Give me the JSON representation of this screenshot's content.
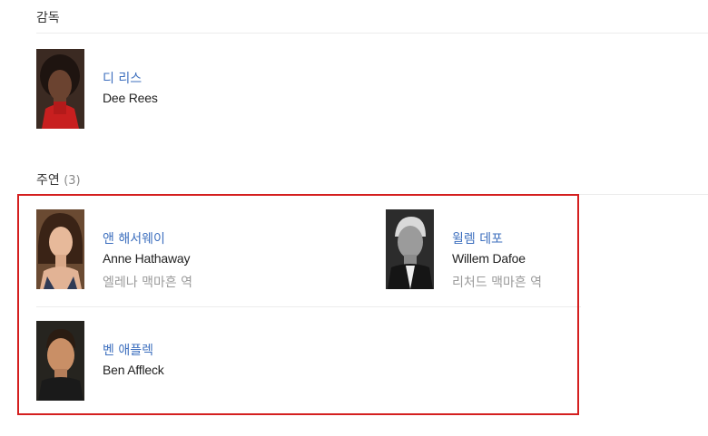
{
  "director_section": {
    "title": "감독",
    "people": [
      {
        "name_ko": "디 리스",
        "name_en": "Dee Rees",
        "photo": "dee-rees-photo"
      }
    ]
  },
  "cast_section": {
    "title": "주연",
    "count": "(3)",
    "people": [
      {
        "name_ko": "앤 해서웨이",
        "name_en": "Anne Hathaway",
        "role": "엘레나 맥마흔 역",
        "photo": "anne-hathaway-photo"
      },
      {
        "name_ko": "윌렘 데포",
        "name_en": "Willem Dafoe",
        "role": "리처드 맥마흔 역",
        "photo": "willem-dafoe-photo"
      },
      {
        "name_ko": "벤 애플렉",
        "name_en": "Ben Affleck",
        "photo": "ben-affleck-photo"
      }
    ]
  },
  "colors": {
    "link": "#3d6fbe",
    "highlight_border": "#d41f1f",
    "muted": "#9a9a9a"
  }
}
